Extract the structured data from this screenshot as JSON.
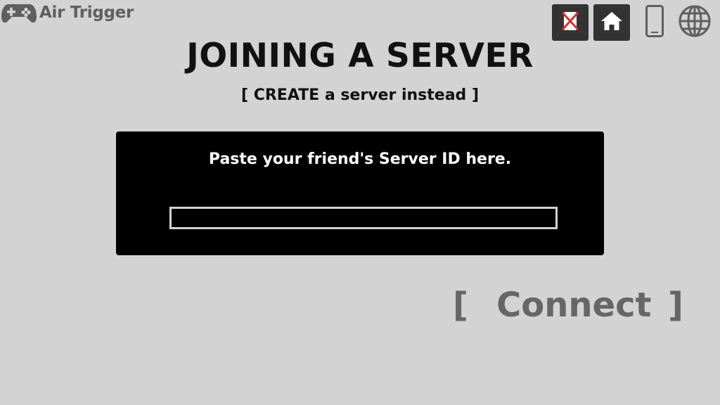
{
  "app": {
    "brand_name": "Air Trigger",
    "logo_icon": "gamepad-icon"
  },
  "toolbar": {
    "close_icon": "close-icon",
    "home_icon": "home-icon",
    "device_icon": "phone-icon",
    "language_icon": "globe-icon"
  },
  "page": {
    "title": "JOINING A SERVER",
    "create_link": "[ CREATE a server instead ]"
  },
  "join_form": {
    "label": "Paste your friend's Server ID here.",
    "server_id_value": "",
    "placeholder": ""
  },
  "connect_button": {
    "bracket_left": "[",
    "label": "Connect",
    "bracket_right": "]"
  },
  "colors": {
    "background": "#d3d3d3",
    "panel": "#000000",
    "title_text": "#111111",
    "connect_text": "#666666",
    "brand_text": "#5f5f5f",
    "toolbar_button": "#333333",
    "close_x": "#d92e2e"
  }
}
